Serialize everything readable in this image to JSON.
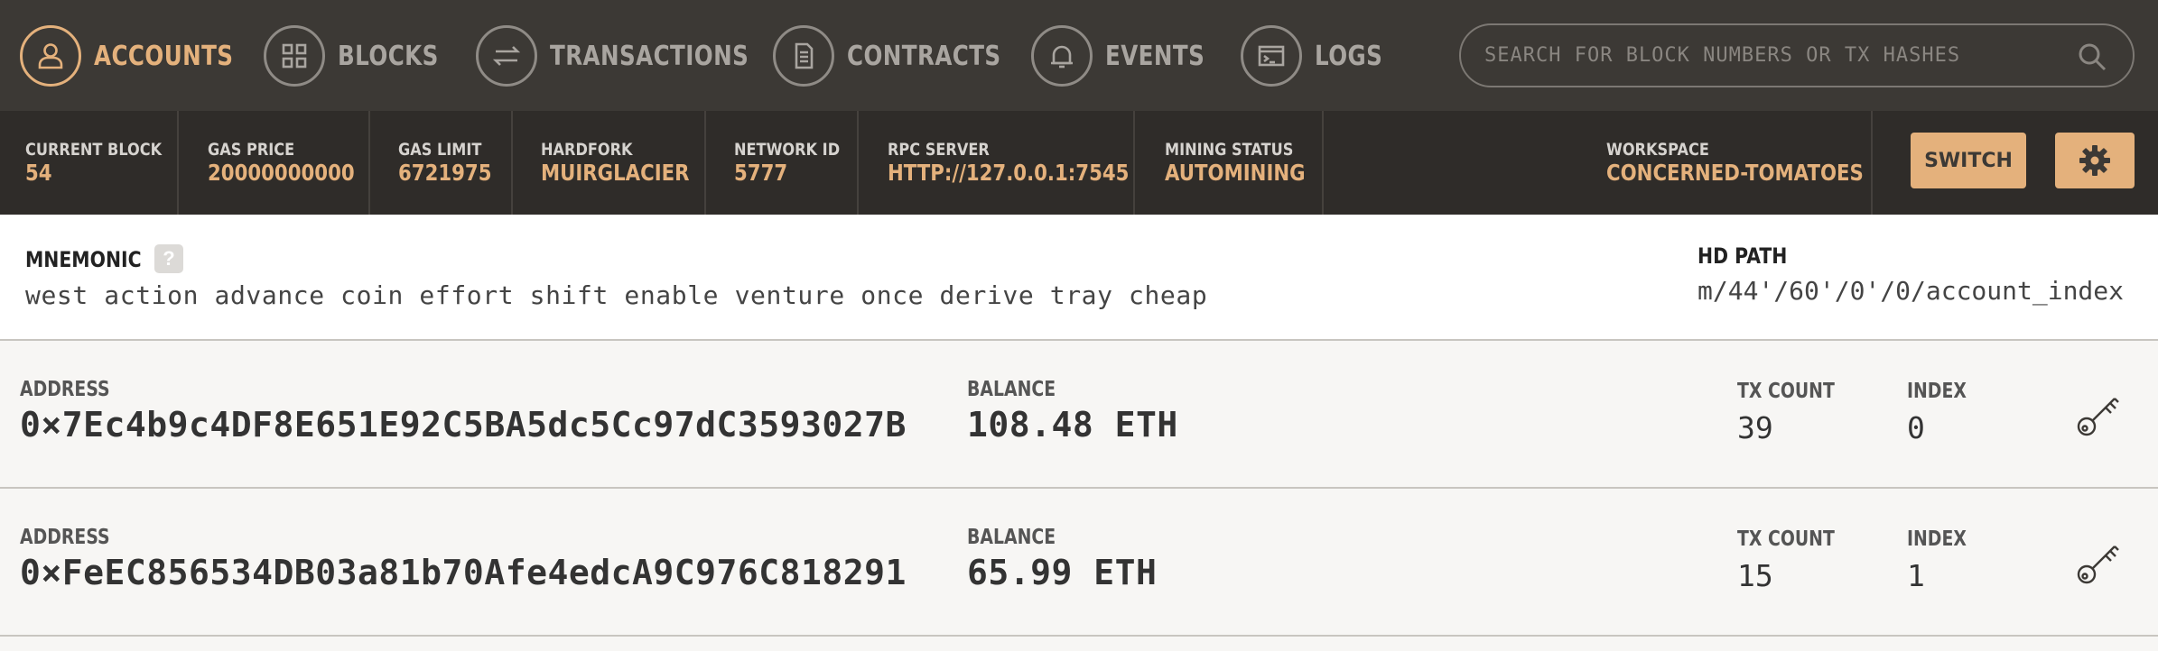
{
  "nav": {
    "items": [
      {
        "label": "ACCOUNTS",
        "icon": "user-icon",
        "active": true
      },
      {
        "label": "BLOCKS",
        "icon": "grid-icon",
        "active": false
      },
      {
        "label": "TRANSACTIONS",
        "icon": "arrows-icon",
        "active": false
      },
      {
        "label": "CONTRACTS",
        "icon": "document-icon",
        "active": false
      },
      {
        "label": "EVENTS",
        "icon": "bell-icon",
        "active": false
      },
      {
        "label": "LOGS",
        "icon": "terminal-icon",
        "active": false
      }
    ],
    "search_placeholder": "SEARCH FOR BLOCK NUMBERS OR TX HASHES"
  },
  "status": {
    "current_block_label": "CURRENT BLOCK",
    "current_block": "54",
    "gas_price_label": "GAS PRICE",
    "gas_price": "20000000000",
    "gas_limit_label": "GAS LIMIT",
    "gas_limit": "6721975",
    "hardfork_label": "HARDFORK",
    "hardfork": "MUIRGLACIER",
    "network_id_label": "NETWORK ID",
    "network_id": "5777",
    "rpc_server_label": "RPC SERVER",
    "rpc_server": "HTTP://127.0.0.1:7545",
    "mining_status_label": "MINING STATUS",
    "mining_status": "AUTOMINING",
    "workspace_label": "WORKSPACE",
    "workspace": "CONCERNED-TOMATOES",
    "switch_label": "SWITCH"
  },
  "mnemonic": {
    "title": "MNEMONIC",
    "help": "?",
    "words": "west action advance coin effort shift enable venture once derive tray cheap",
    "hd_path_title": "HD PATH",
    "hd_path": "m/44'/60'/0'/0/account_index"
  },
  "accounts": [
    {
      "address_label": "ADDRESS",
      "address": "0×7Ec4b9c4DF8E651E92C5BA5dc5Cc97dC3593027B",
      "balance_label": "BALANCE",
      "balance": "108.48 ETH",
      "tx_count_label": "TX COUNT",
      "tx_count": "39",
      "index_label": "INDEX",
      "index": "0"
    },
    {
      "address_label": "ADDRESS",
      "address": "0×FeEC856534DB03a81b70Afe4edcA9C976C818291",
      "balance_label": "BALANCE",
      "balance": "65.99 ETH",
      "tx_count_label": "TX COUNT",
      "tx_count": "15",
      "index_label": "INDEX",
      "index": "1"
    }
  ],
  "colors": {
    "accent": "#e4b17c",
    "nav_bg": "#3c3935",
    "status_bg": "#2f2c29"
  }
}
